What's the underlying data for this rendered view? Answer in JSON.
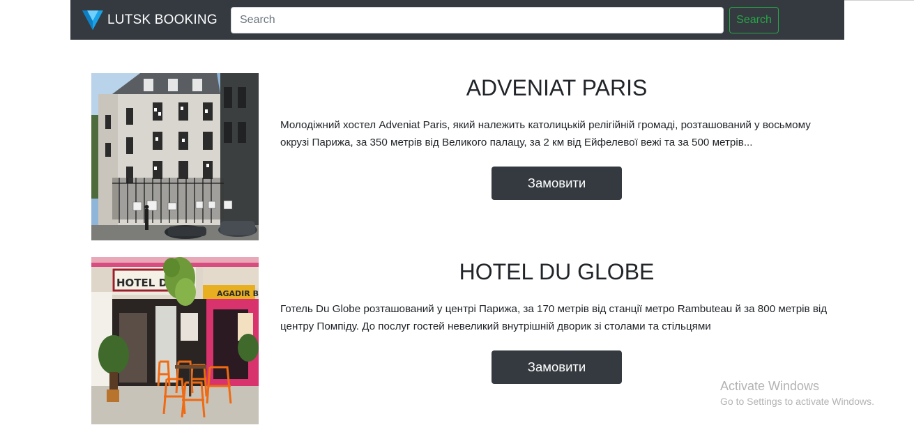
{
  "navbar": {
    "brand": "LUTSK BOOKING",
    "search_placeholder": "Search",
    "search_button": "Search",
    "colors": {
      "background": "#343a40",
      "accent": "#28a745",
      "logo": "#1aa3e8"
    }
  },
  "hotels": [
    {
      "name": "ADVENIAT PARIS",
      "description": "Молодіжний хостел Adveniat Paris, який належить католицькій релігійній громаді, розташований у восьмому окрузі Парижа, за 350 метрів від Великого палацу, за 2 км від Ейфелевої вежі та за 500 метрів...",
      "button": "Замовити",
      "image": "building-photo"
    },
    {
      "name": "HOTEL DU GLOBE",
      "description": "Готель Du Globe розташований у центрі Парижа, за 170 метрів від станції метро Rambuteau й за 800 метрів від центру Помпіду. До послуг гостей невеликий внутрішній дворик зі столами та стільцями",
      "button": "Замовити",
      "image": "hotel-storefront-photo",
      "sign_text": "HOTEL DU GL",
      "bar_sign_text": "AGADIR BAR"
    }
  ],
  "overlay": {
    "title": "Activate Windows",
    "subtitle": "Go to Settings to activate Windows."
  }
}
